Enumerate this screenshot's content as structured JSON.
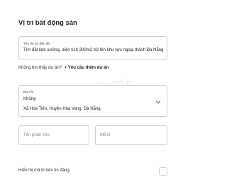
{
  "section": {
    "title": "Vị trí bất động sản"
  },
  "project_field": {
    "label": "Tên dự án đất nền",
    "value": "Tìm đất làm xưởng, diện tích 300m2 trở lên khu vực ngoại thành Đà Nẵng"
  },
  "hint": {
    "text": "Không tìm thấy dự án?",
    "plus": "+",
    "link": "Yêu cầu thêm dự án"
  },
  "address_field": {
    "label": "Địa chỉ",
    "line1": "Không",
    "line2": "Xã Hòa Tiến, Huyện Hòa Vang, Đà Nẵng"
  },
  "subdivision_field": {
    "placeholder": "Tên phân khu"
  },
  "lot_field": {
    "placeholder": "Mã lô"
  },
  "toggle_row": {
    "label": "Hiển thị mã lô trên tin đăng"
  },
  "watermark": {
    "text": "chợTỐT"
  },
  "colors": {
    "border": "#cfcfcf",
    "text": "#222222",
    "placeholder": "#8a8a8a"
  },
  "icons": {
    "address_chevron": "chevron-down-icon"
  }
}
